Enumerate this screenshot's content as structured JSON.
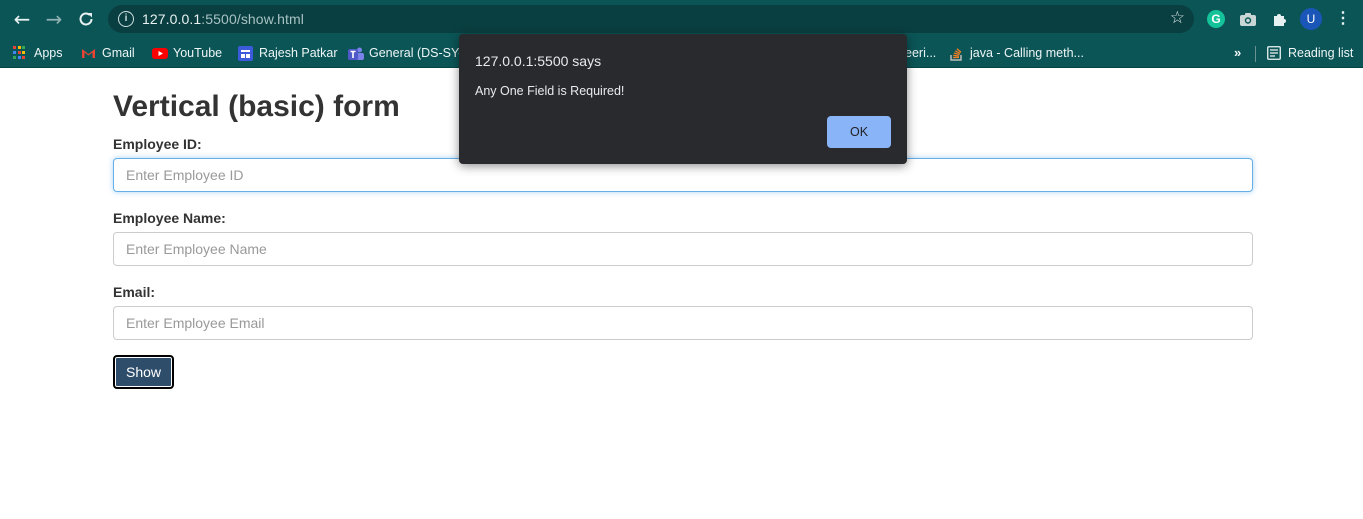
{
  "browser": {
    "url_host": "127.0.0.1",
    "url_rest": ":5500/show.html",
    "avatar_letter": "U",
    "grammarly_letter": "G",
    "reading_list_label": "Reading list",
    "bookmarks": [
      {
        "label": "Apps",
        "icon": "apps-grid-icon"
      },
      {
        "label": "Gmail",
        "icon": "gmail-icon"
      },
      {
        "label": "YouTube",
        "icon": "youtube-icon"
      },
      {
        "label": "Rajesh Patkar",
        "icon": "bookmark-site-icon"
      },
      {
        "label": "General (DS-SY-",
        "icon": "teams-icon"
      },
      {
        "label": "eeri...",
        "icon": "bookmark-site-icon"
      },
      {
        "label": "java - Calling meth...",
        "icon": "stackoverflow-icon"
      }
    ],
    "bookmarks_overflow": "»"
  },
  "page": {
    "title": "Vertical (basic) form",
    "fields": [
      {
        "label": "Employee ID:",
        "placeholder": "Enter Employee ID"
      },
      {
        "label": "Employee Name:",
        "placeholder": "Enter Employee Name"
      },
      {
        "label": "Email:",
        "placeholder": "Enter Employee Email"
      }
    ],
    "submit_label": "Show"
  },
  "alert": {
    "title": "127.0.0.1:5500 says",
    "message": "Any One Field is Required!",
    "ok_label": "OK"
  },
  "colors": {
    "chrome_bg": "#0b5557",
    "dialog_bg": "#292a2d",
    "ok_button": "#8ab4f8",
    "show_button": "#2e4d6b"
  }
}
